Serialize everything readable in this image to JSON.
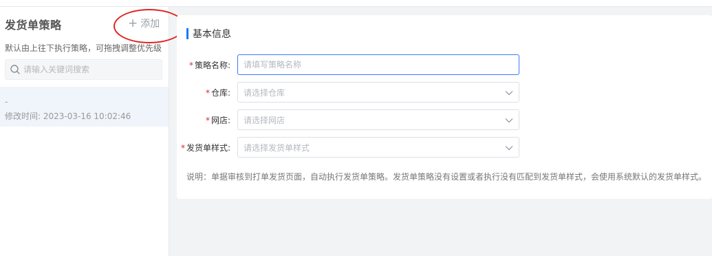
{
  "sidebar": {
    "title": "发货单策略",
    "add_label": "添加",
    "description": "默认由上往下执行策略，可拖拽调整优先级",
    "search_placeholder": "请输入关键词搜索",
    "items": [
      {
        "name": "-",
        "modified": "修改时间: 2023-03-16 10:02:46"
      }
    ]
  },
  "main": {
    "section_title": "基本信息",
    "fields": [
      {
        "label": "策略名称:",
        "required": true,
        "type": "input",
        "placeholder": "请填写策略名称",
        "value": ""
      },
      {
        "label": "仓库:",
        "required": true,
        "type": "select",
        "placeholder": "请选择仓库"
      },
      {
        "label": "网店:",
        "required": true,
        "type": "select",
        "placeholder": "请选择网店"
      },
      {
        "label": "发货单样式:",
        "required": true,
        "type": "select",
        "placeholder": "请选择发货单样式"
      }
    ],
    "note": "说明：单据审核到打单发货页面，自动执行发货单策略。发货单策略没有设置或者执行没有匹配到发货单样式，会使用系统默认的发货单样式。"
  },
  "colors": {
    "accent": "#1677ff",
    "required": "#e02424",
    "annotation": "#e02424",
    "selected_item_bg": "#f0f4fb"
  },
  "icons": {
    "add": "plus-icon",
    "search": "search-icon",
    "select": "chevron-down-icon"
  }
}
